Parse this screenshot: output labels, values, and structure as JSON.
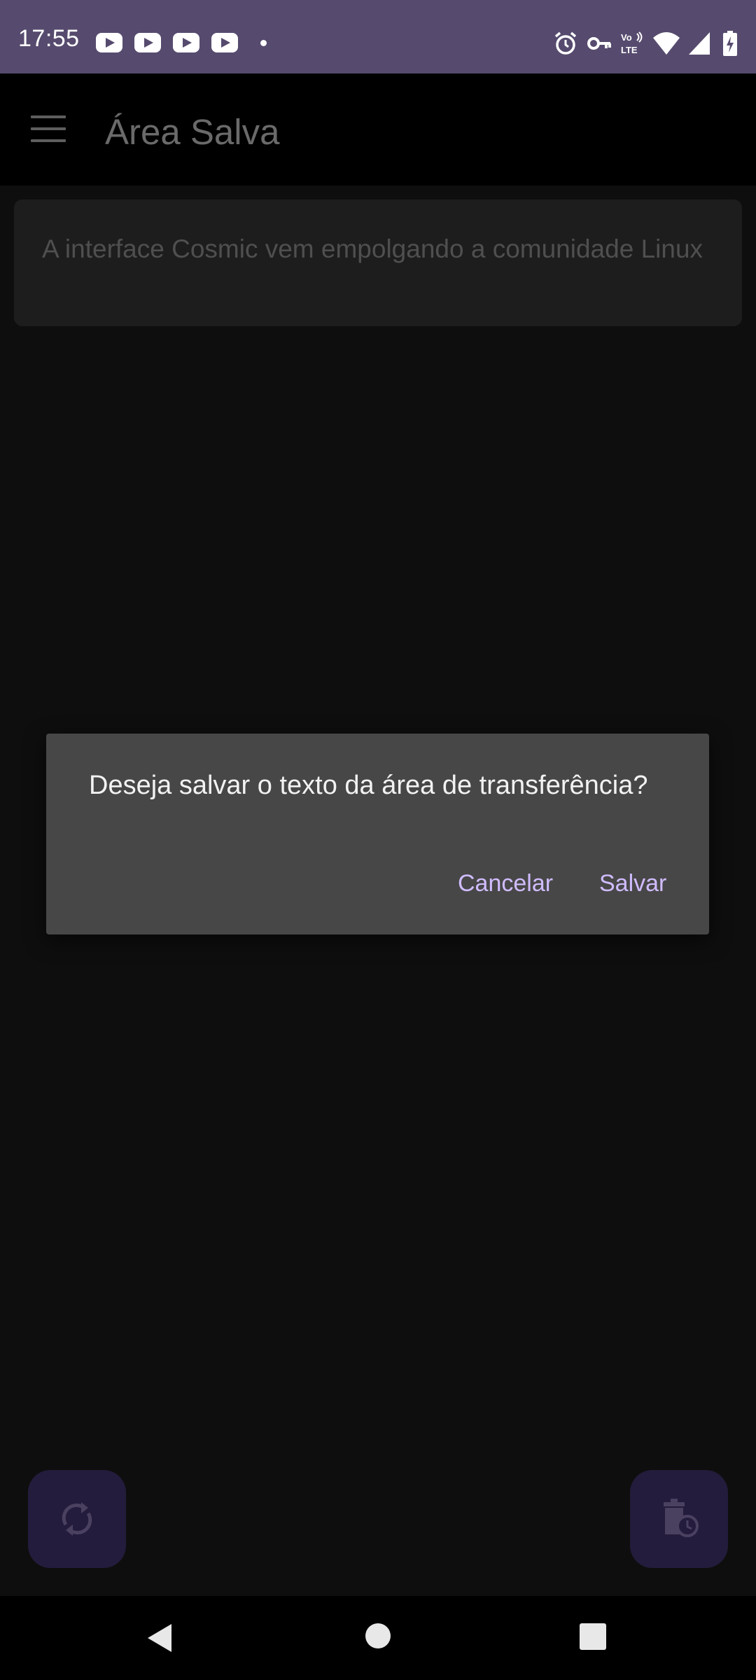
{
  "status_bar": {
    "time": "17:55",
    "notification_icons": [
      "youtube-icon",
      "youtube-icon",
      "youtube-icon",
      "youtube-icon",
      "more-dot-icon"
    ],
    "system_icons": [
      "alarm-icon",
      "vpn-key-icon",
      "volte-lte-icon",
      "wifi-icon",
      "signal-icon",
      "battery-charging-icon"
    ]
  },
  "app_bar": {
    "menu_icon": "menu-icon",
    "title": "Área Salva"
  },
  "saved_items": [
    {
      "text": "A interface Cosmic vem empolgando a comunidade Linux"
    }
  ],
  "dialog": {
    "message": "Deseja salvar o texto da área de transferência?",
    "cancel_label": "Cancelar",
    "save_label": "Salvar"
  },
  "fabs": {
    "left_icon": "sync-icon",
    "right_icon": "delete-history-icon"
  },
  "nav": {
    "back_icon": "back-icon",
    "home_icon": "home-icon",
    "recents_icon": "recents-icon"
  },
  "colors": {
    "status_bar": "#564b6e",
    "dialog_bg": "#474747",
    "dialog_button_text": "#d0bcff",
    "fab_bg": "#241c3c"
  }
}
